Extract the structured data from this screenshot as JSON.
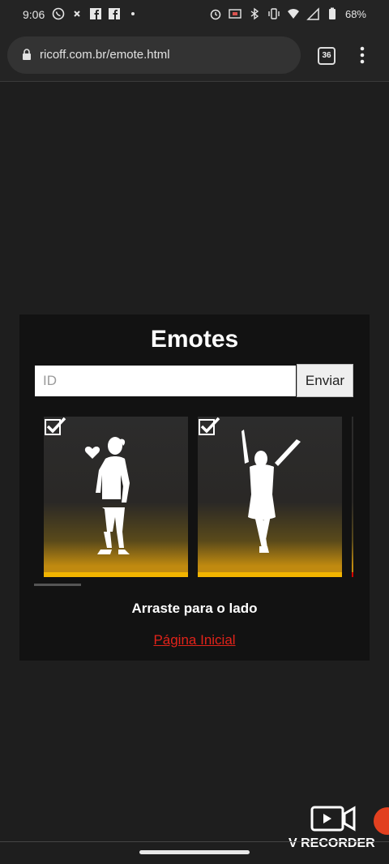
{
  "status_bar": {
    "time": "9:06",
    "battery": "68%"
  },
  "browser": {
    "url": "ricoff.com.br/emote.html",
    "tab_count": "36"
  },
  "page": {
    "title": "Emotes",
    "id_input": {
      "placeholder": "ID",
      "value": ""
    },
    "send_label": "Enviar",
    "emotes": [
      {
        "icon": "heart-emote-figure"
      },
      {
        "icon": "wave-emote-figure"
      }
    ],
    "hint": "Arraste para o lado",
    "home_link": "Página Inicial"
  },
  "recorder": {
    "label": "V RECORDER"
  },
  "colors": {
    "accent": "#f2b400",
    "link": "#e2231a",
    "background": "#1e1e1e",
    "card": "#121212"
  }
}
